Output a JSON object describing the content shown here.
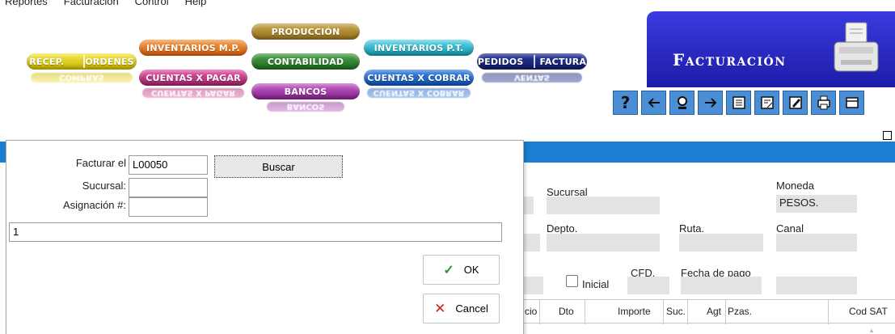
{
  "menu": [
    "Reportes",
    "Facturación",
    "Control",
    "Help"
  ],
  "modules": {
    "recep": "RECEP.",
    "ordenes": "ORDENES",
    "inventarios_mp": "INVENTARIOS M.P.",
    "cuentas_pagar": "CUENTAS X PAGAR",
    "produccion": "PRODUCCIÓN",
    "contabilidad": "CONTABILIDAD",
    "bancos": "BANCOS",
    "inventarios_pt": "INVENTARIOS P.T.",
    "cuentas_cobrar": "CUENTAS X COBRAR",
    "pedidos": "PEDIDOS",
    "factura": "FACTURA",
    "reflections": {
      "compras": "COMPRAS",
      "cuentas_pagar": "CUENTAS X PAGAR",
      "bancos": "BANCOS",
      "cuentas_cobrar": "CUENTAS X COBRAR",
      "ventas": "VENTAS"
    }
  },
  "title_panel": {
    "title": "Facturación"
  },
  "toolbar": {
    "icons": [
      "help-icon",
      "arrow-left-icon",
      "search-icon",
      "arrow-right-icon",
      "list-icon",
      "document-icon",
      "edit-icon",
      "print-icon",
      "window-icon"
    ],
    "help_glyph": "?"
  },
  "form": {
    "sucursal_label": "Sucursal",
    "moneda_label": "Moneda",
    "moneda_value": "PESOS.",
    "depto_label": "Depto.",
    "ruta_label": "Ruta.",
    "canal_label": "Canal",
    "cfd_label": "CFD.",
    "fecha_pago_label": "Fecha de pago",
    "inicial_label": "Inicial"
  },
  "grid": {
    "columns": [
      "cio",
      "Dto",
      "Importe",
      "Suc.",
      "Agt",
      "Pzas.",
      "Cod SAT"
    ]
  },
  "dialog": {
    "facturar_label": "Facturar el",
    "facturar_value": "L00050",
    "buscar_label": "Buscar",
    "sucursal_label": "Sucursal:",
    "sucursal_value": "",
    "asignacion_label": "Asignación #:",
    "asignacion_value": "",
    "long_value": "1",
    "ok_label": "OK",
    "cancel_label": "Cancel"
  },
  "colors": {
    "accent_blue": "#1b7fd1",
    "title_panel": "#2a2ac8",
    "toolbar_button": "#4a8fd6"
  }
}
